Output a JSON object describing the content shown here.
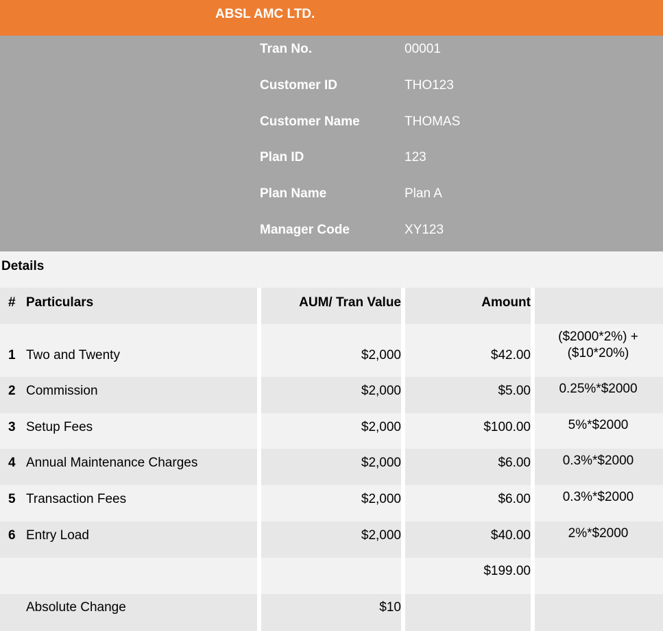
{
  "header": {
    "title": "ABSL AMC LTD."
  },
  "info": [
    {
      "label": "Tran No.",
      "value": "00001"
    },
    {
      "label": "Customer ID",
      "value": "THO123"
    },
    {
      "label": "Customer Name",
      "value": "THOMAS"
    },
    {
      "label": "Plan ID",
      "value": "123"
    },
    {
      "label": "Plan Name",
      "value": "Plan A"
    },
    {
      "label": "Manager Code",
      "value": "XY123"
    }
  ],
  "details": {
    "title": "Details",
    "columns": {
      "num": "#",
      "particulars": "Particulars",
      "aum": "AUM/ Tran Value",
      "amount": "Amount"
    },
    "rows": [
      {
        "num": "1",
        "particulars": "Two and Twenty",
        "aum": "$2,000",
        "amount": "$42.00",
        "formula_line1": "($2000*2%) +",
        "formula_line2": "($10*20%)"
      },
      {
        "num": "2",
        "particulars": "Commission",
        "aum": "$2,000",
        "amount": "$5.00",
        "formula_line1": "0.25%*$2000"
      },
      {
        "num": "3",
        "particulars": "Setup Fees",
        "aum": "$2,000",
        "amount": "$100.00",
        "formula_line1": "5%*$2000"
      },
      {
        "num": "4",
        "particulars": "Annual Maintenance Charges",
        "aum": "$2,000",
        "amount": "$6.00",
        "formula_line1": "0.3%*$2000"
      },
      {
        "num": "5",
        "particulars": "Transaction Fees",
        "aum": "$2,000",
        "amount": "$6.00",
        "formula_line1": "0.3%*$2000"
      },
      {
        "num": "6",
        "particulars": "Entry Load",
        "aum": "$2,000",
        "amount": "$40.00",
        "formula_line1": "2%*$2000"
      }
    ],
    "total": "$199.00",
    "absolute_change": {
      "label": "Absolute Change",
      "value": "$10"
    }
  }
}
